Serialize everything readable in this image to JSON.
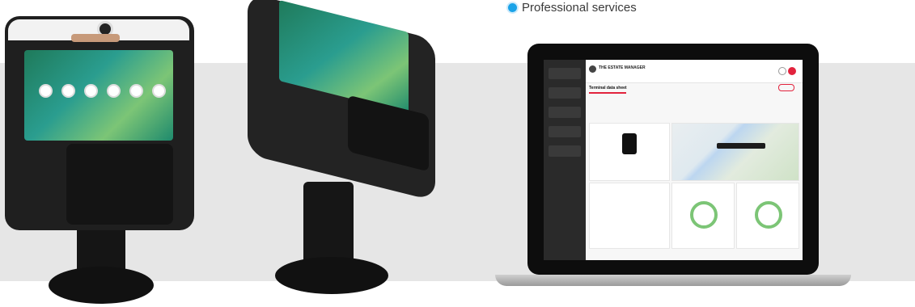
{
  "bullets": [
    "Professional services"
  ],
  "colors": {
    "accent": "#1aa3e8",
    "laptop_accent": "#e2233d",
    "ring": "#7cc576",
    "terminal": "#1f1f1f"
  },
  "laptop": {
    "app_title": "THE ESTATE MANAGER",
    "page_title": "Terminal data sheet"
  }
}
